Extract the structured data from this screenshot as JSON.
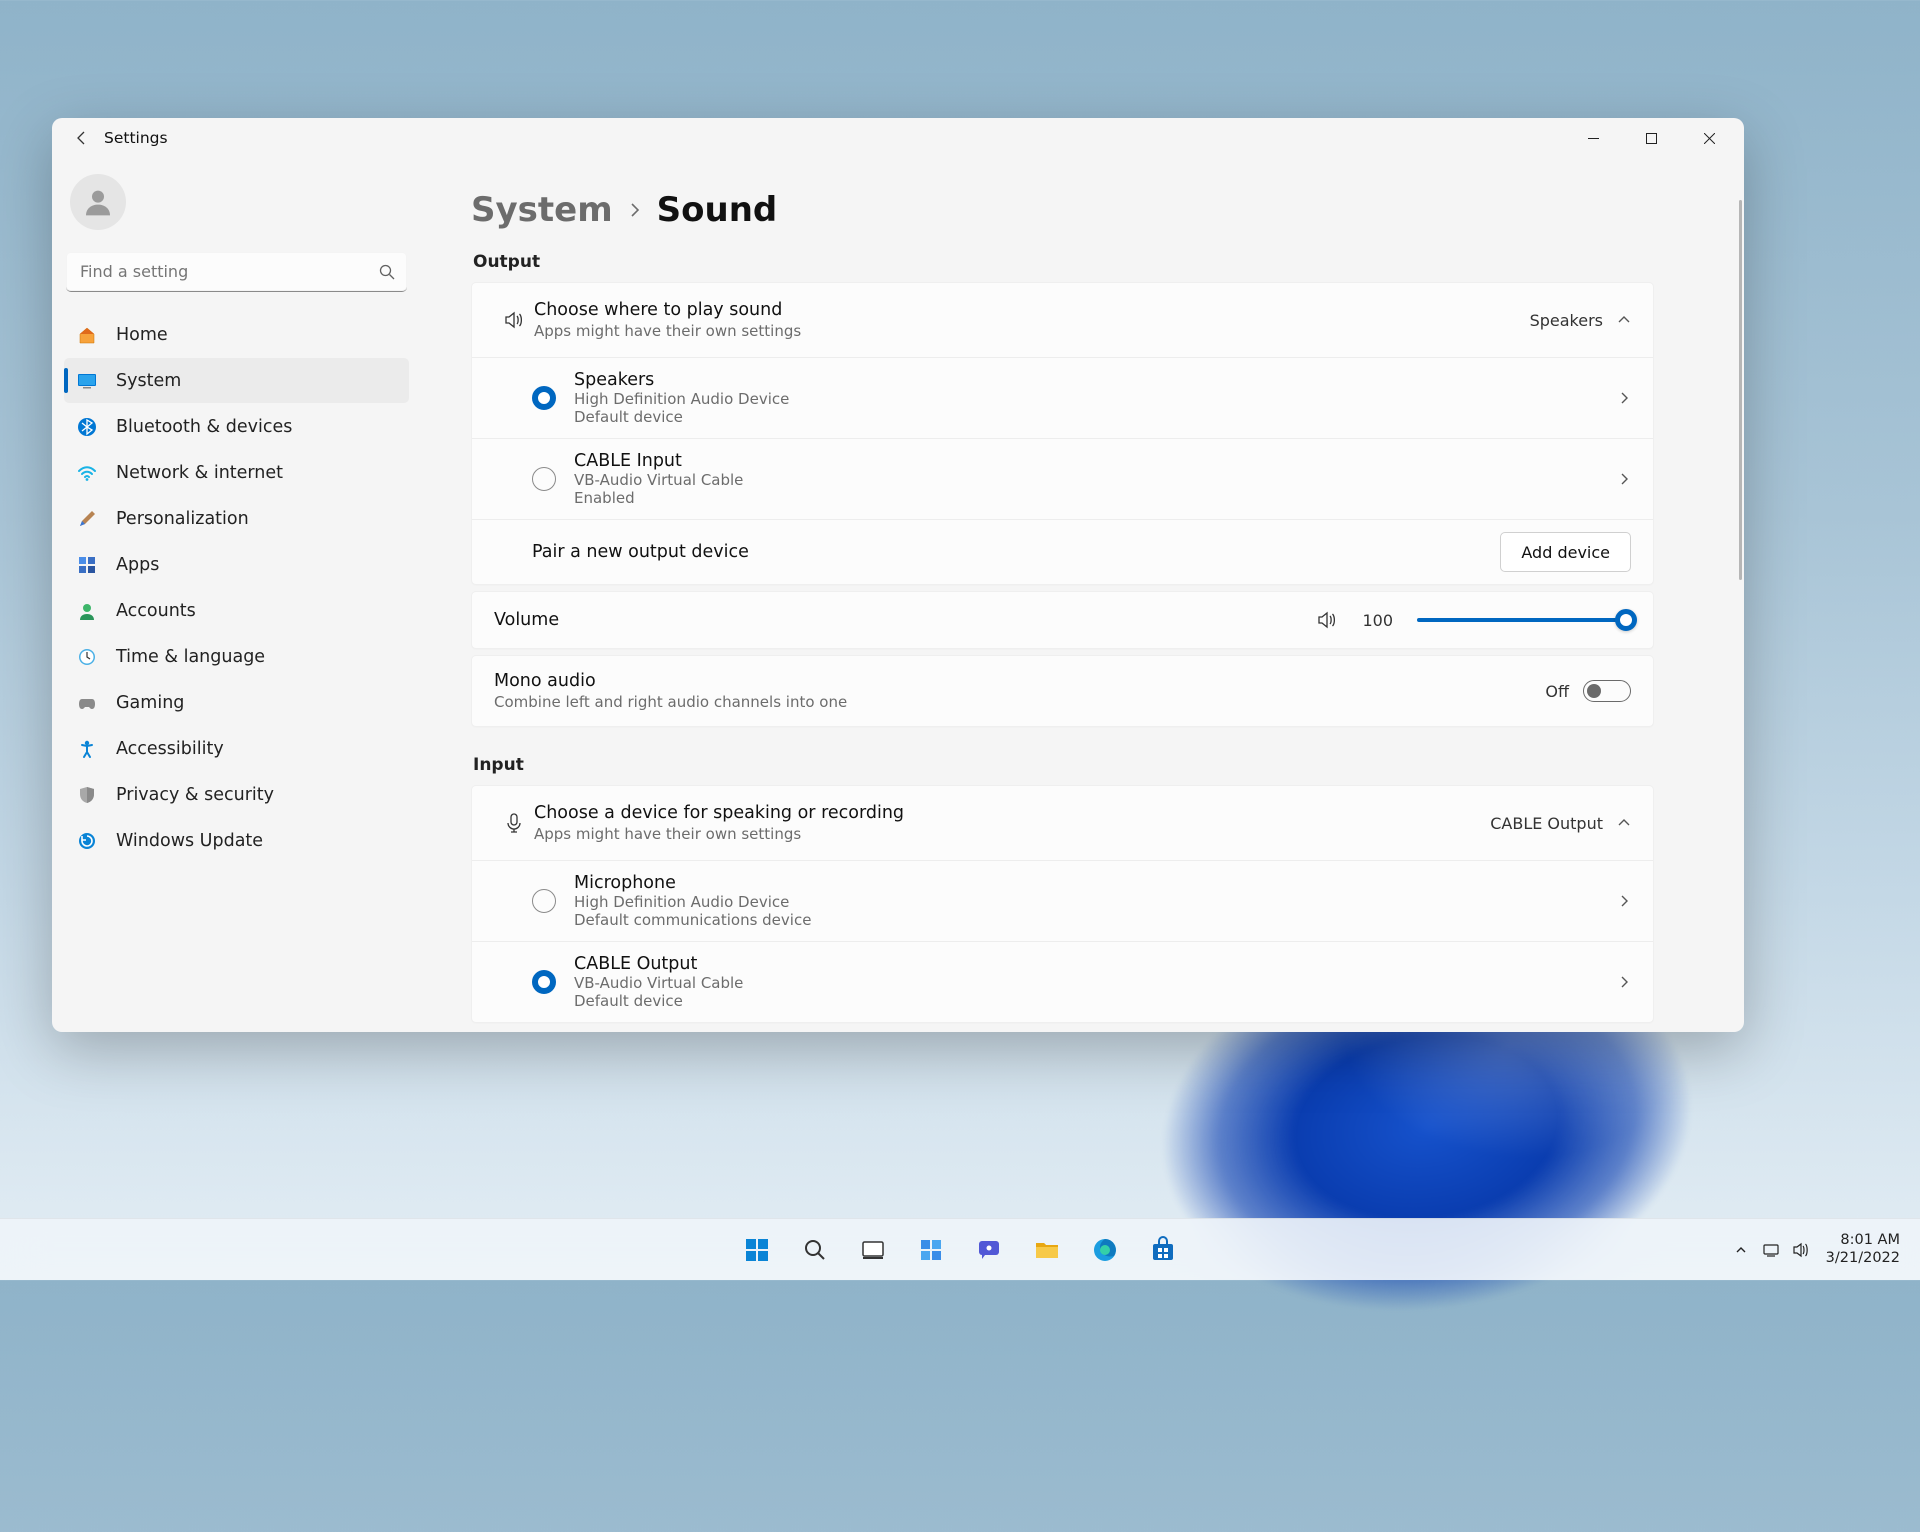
{
  "window": {
    "title": "Settings"
  },
  "search": {
    "placeholder": "Find a setting"
  },
  "nav": {
    "items": [
      {
        "label": "Home"
      },
      {
        "label": "System"
      },
      {
        "label": "Bluetooth & devices"
      },
      {
        "label": "Network & internet"
      },
      {
        "label": "Personalization"
      },
      {
        "label": "Apps"
      },
      {
        "label": "Accounts"
      },
      {
        "label": "Time & language"
      },
      {
        "label": "Gaming"
      },
      {
        "label": "Accessibility"
      },
      {
        "label": "Privacy & security"
      },
      {
        "label": "Windows Update"
      }
    ]
  },
  "breadcrumb": {
    "category": "System",
    "page": "Sound"
  },
  "sections": {
    "output_label": "Output",
    "input_label": "Input"
  },
  "output": {
    "header": {
      "title": "Choose where to play sound",
      "subtitle": "Apps might have their own settings",
      "selected": "Speakers"
    },
    "devices": [
      {
        "name": "Speakers",
        "line2": "High Definition Audio Device",
        "line3": "Default device",
        "selected": true
      },
      {
        "name": "CABLE Input",
        "line2": "VB-Audio Virtual Cable",
        "line3": "Enabled",
        "selected": false
      }
    ],
    "pair": {
      "label": "Pair a new output device",
      "button": "Add device"
    }
  },
  "volume": {
    "label": "Volume",
    "value": "100"
  },
  "mono": {
    "title": "Mono audio",
    "subtitle": "Combine left and right audio channels into one",
    "state": "Off"
  },
  "input": {
    "header": {
      "title": "Choose a device for speaking or recording",
      "subtitle": "Apps might have their own settings",
      "selected": "CABLE Output"
    },
    "devices": [
      {
        "name": "Microphone",
        "line2": "High Definition Audio Device",
        "line3": "Default communications device",
        "selected": false
      },
      {
        "name": "CABLE Output",
        "line2": "VB-Audio Virtual Cable",
        "line3": "Default device",
        "selected": true
      }
    ]
  },
  "tray": {
    "time": "8:01 AM",
    "date": "3/21/2022"
  }
}
